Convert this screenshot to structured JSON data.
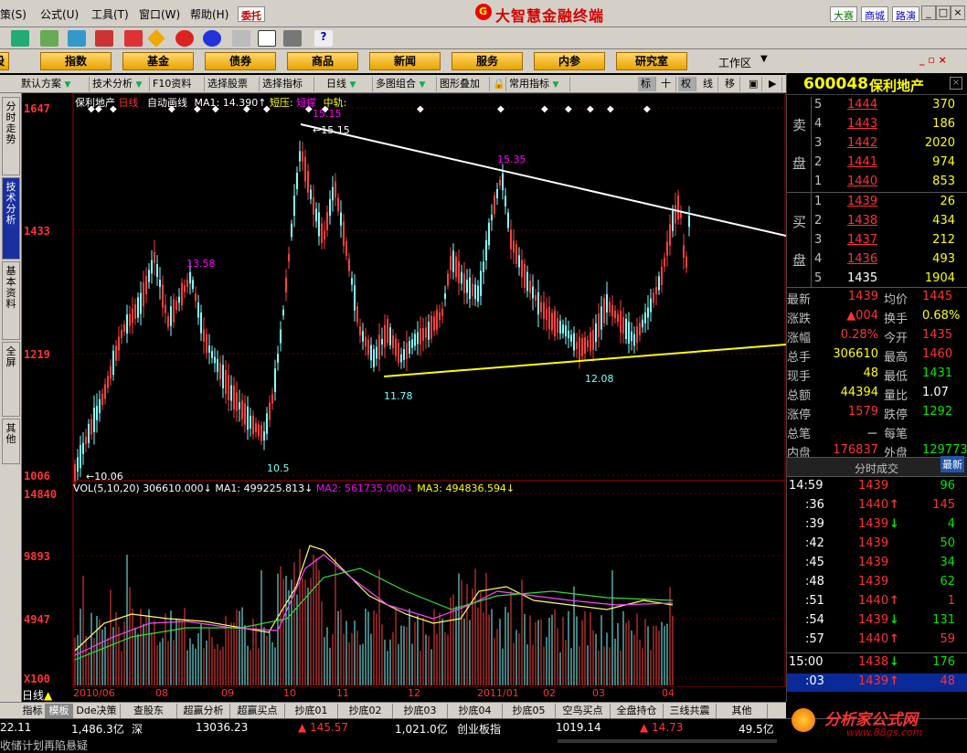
{
  "menubar": {
    "items": [
      "策(S)",
      "公式(U)",
      "工具(T)",
      "窗口(W)",
      "帮助(H)"
    ],
    "entrust": "委托",
    "title": "大智慧金融终端",
    "right_links": [
      "大赛",
      "商城",
      "路演"
    ]
  },
  "nav": {
    "buttons": [
      "股",
      "指数",
      "基金",
      "债券",
      "商品",
      "新闻",
      "服务",
      "内参",
      "研究室"
    ],
    "workspace": "工作区"
  },
  "chartbar": {
    "items": [
      "默认方案",
      "技术分析",
      "F10资料",
      "选择股票",
      "选择指标",
      "日线",
      "多图组合",
      "图形叠加",
      "常用指标"
    ],
    "right_buttons": [
      "标",
      "十",
      "权",
      "线",
      "移"
    ]
  },
  "left_tabs": [
    "分时走势",
    "技术分析",
    "基本资料",
    "全屏",
    "其他"
  ],
  "chart": {
    "info_line": {
      "name": "保利地产",
      "period": "日线",
      "auto_line": "自动画线",
      "ma1": "MA1: 14.390↑",
      "short_pressure": "短压:",
      "short_support": "短撑",
      "mid_track": "中轨:"
    },
    "y_labels": [
      "1647",
      "1433",
      "1219",
      "1006"
    ],
    "price_annotations": [
      "15.15",
      "15.35",
      "13.58",
      "11.78",
      "12.08",
      "10.5",
      "10.06"
    ],
    "vol_info": {
      "name": "VOL(5,10,20)",
      "value": "306610.000↓",
      "ma1": "MA1: 499225.813↓",
      "ma2": "MA2: 561735.000↓",
      "ma3": "MA3: 494836.594↓"
    },
    "vol_y_labels": [
      "14840",
      "9893",
      "4947",
      "X100"
    ],
    "x_labels": [
      "日线",
      "2010/06",
      "08",
      "09",
      "10",
      "11",
      "12",
      "2011/01",
      "02",
      "03",
      "04"
    ]
  },
  "bottom_tabs": [
    "指标",
    "模板",
    "Dde决策",
    "查股东",
    "超赢分析",
    "超赢买点",
    "抄底01",
    "抄底02",
    "抄底03",
    "抄底04",
    "抄底05",
    "空鸟买点",
    "全盘持仓",
    "三线共震",
    "其他"
  ],
  "statusbar": {
    "v1": "22.11",
    "sh_amount": "1,486.3亿",
    "sz_label": "深",
    "sz_index": "13036.23",
    "sz_change": "▲ 145.57",
    "sz_amount": "1,021.0亿",
    "gem_label": "创业板指",
    "gem_index": "1019.14",
    "gem_change": "▲ 14.73",
    "gem_amount": "49.5亿",
    "ticker": "收储计划再陷悬疑",
    "watermark": "分析家公式网",
    "watermark_url": "www.88gs.com"
  },
  "quote": {
    "code": "600048",
    "name": "保利地产",
    "sell_label": [
      "卖",
      "盘"
    ],
    "buy_label": [
      "买",
      "盘"
    ],
    "sell": [
      {
        "level": "5",
        "price": "1444",
        "vol": "370"
      },
      {
        "level": "4",
        "price": "1443",
        "vol": "186"
      },
      {
        "level": "3",
        "price": "1442",
        "vol": "2020"
      },
      {
        "level": "2",
        "price": "1441",
        "vol": "974"
      },
      {
        "level": "1",
        "price": "1440",
        "vol": "853"
      }
    ],
    "buy": [
      {
        "level": "1",
        "price": "1439",
        "vol": "26"
      },
      {
        "level": "2",
        "price": "1438",
        "vol": "434"
      },
      {
        "level": "3",
        "price": "1437",
        "vol": "212"
      },
      {
        "level": "4",
        "price": "1436",
        "vol": "493"
      },
      {
        "level": "5",
        "price": "1435",
        "vol": "1904"
      }
    ],
    "stats": [
      {
        "l": "最新",
        "v": "1439",
        "l2": "均价",
        "v2": "1445"
      },
      {
        "l": "涨跌",
        "v": "▲004",
        "l2": "换手",
        "v2": "0.68%"
      },
      {
        "l": "涨幅",
        "v": "0.28%",
        "l2": "今开",
        "v2": "1435"
      },
      {
        "l": "总手",
        "v": "306610",
        "l2": "最高",
        "v2": "1460"
      },
      {
        "l": "现手",
        "v": "48",
        "l2": "最低",
        "v2": "1431"
      },
      {
        "l": "总额",
        "v": "44394",
        "l2": "量比",
        "v2": "1.07"
      },
      {
        "l": "涨停",
        "v": "1579",
        "l2": "跌停",
        "v2": "1292"
      },
      {
        "l": "总笔",
        "v": "－",
        "l2": "每笔",
        "v2": ""
      },
      {
        "l": "内盘",
        "v": "176837",
        "l2": "外盘",
        "v2": "129773"
      }
    ],
    "ticks_header": "分时成交",
    "latest_btn": "最新",
    "ticks": [
      {
        "t": "14:59",
        "p": "1439",
        "a": "",
        "v": "96",
        "c": "green"
      },
      {
        "t": ":36",
        "p": "1440",
        "a": "↑",
        "v": "145",
        "c": "red"
      },
      {
        "t": ":39",
        "p": "1439",
        "a": "↓",
        "v": "4",
        "c": "green"
      },
      {
        "t": ":42",
        "p": "1439",
        "a": "",
        "v": "50",
        "c": "green"
      },
      {
        "t": ":45",
        "p": "1439",
        "a": "",
        "v": "34",
        "c": "green"
      },
      {
        "t": ":48",
        "p": "1439",
        "a": "",
        "v": "62",
        "c": "green"
      },
      {
        "t": ":51",
        "p": "1440",
        "a": "↑",
        "v": "1",
        "c": "red"
      },
      {
        "t": ":54",
        "p": "1439",
        "a": "↓",
        "v": "131",
        "c": "green"
      },
      {
        "t": ":57",
        "p": "1440",
        "a": "↑",
        "v": "59",
        "c": "red"
      },
      {
        "t": "15:00",
        "p": "1438",
        "a": "↓",
        "v": "176",
        "c": "green"
      },
      {
        "t": ":03",
        "p": "1439",
        "a": "↑",
        "v": "48",
        "c": "red"
      }
    ]
  }
}
